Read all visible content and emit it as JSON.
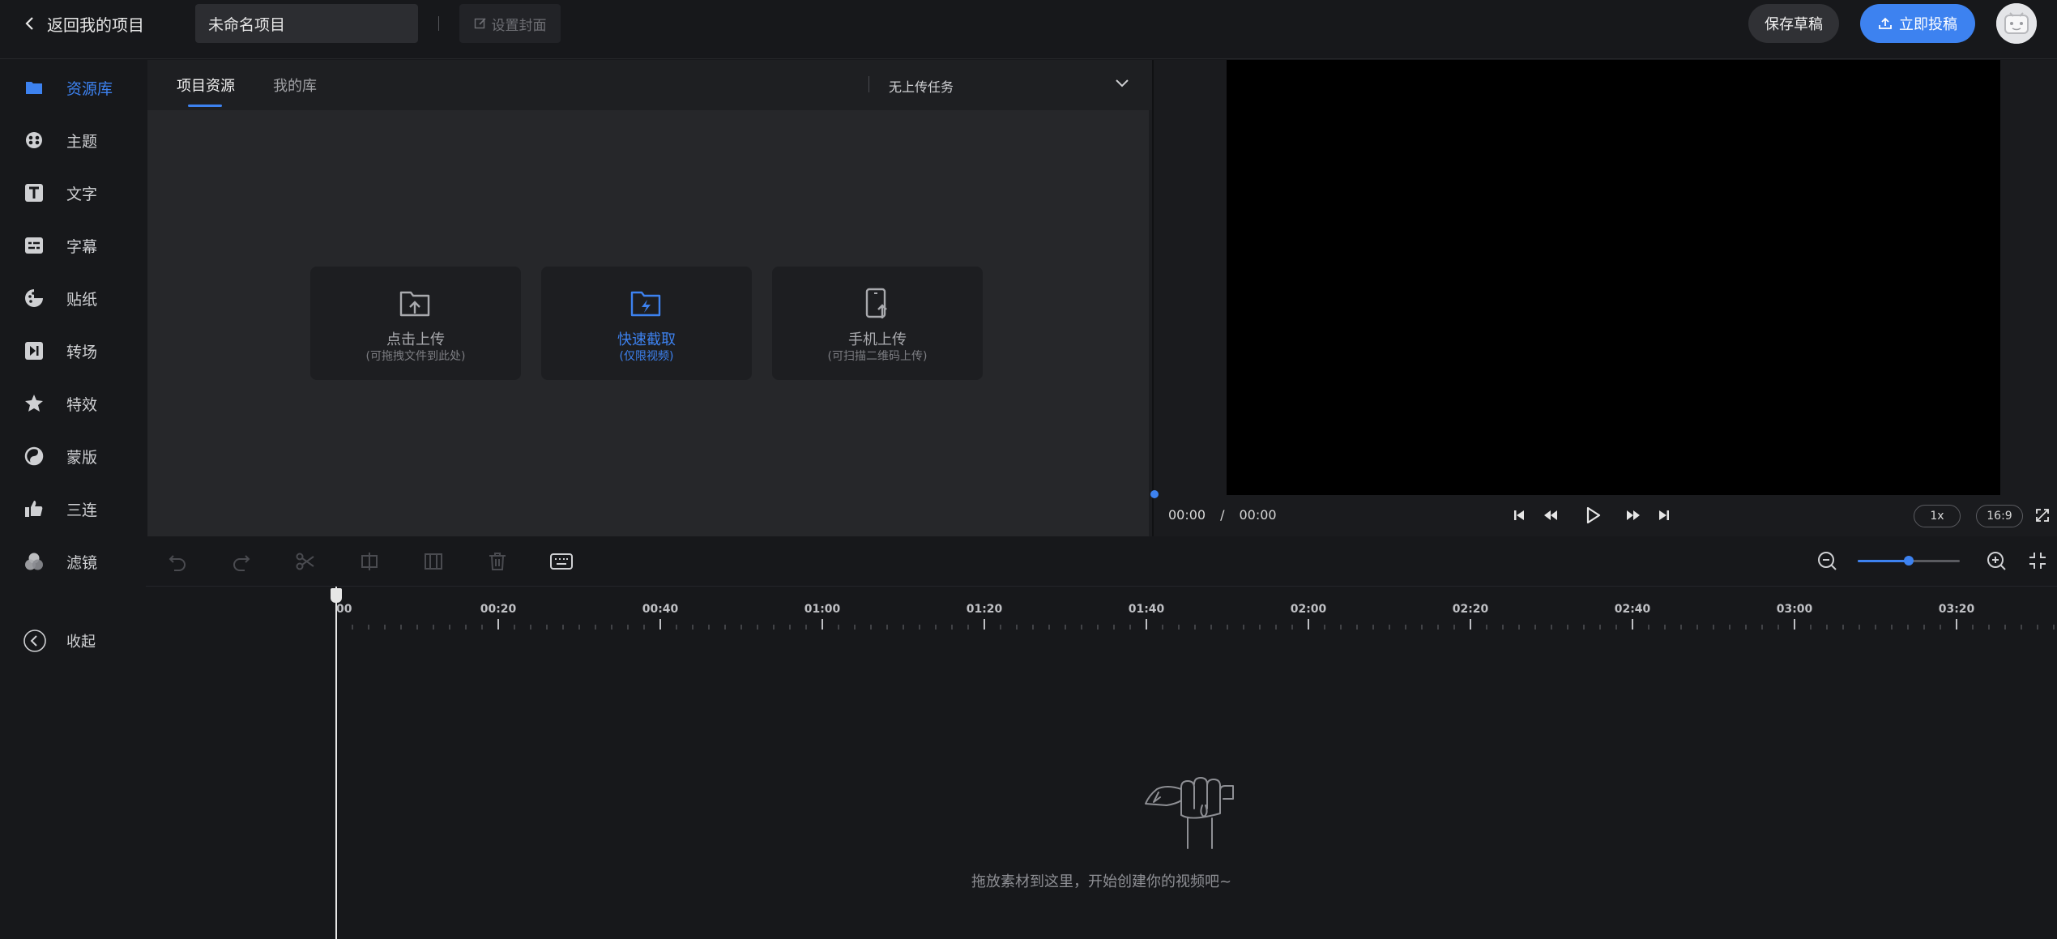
{
  "topbar": {
    "back_label": "返回我的项目",
    "project_name": "未命名项目",
    "cover_label": "设置封面",
    "save_label": "保存草稿",
    "publish_label": "立即投稿"
  },
  "sidebar": {
    "items": [
      {
        "label": "资源库",
        "icon": "folder-icon",
        "active": true
      },
      {
        "label": "主题",
        "icon": "theme-icon",
        "active": false
      },
      {
        "label": "文字",
        "icon": "text-icon",
        "active": false
      },
      {
        "label": "字幕",
        "icon": "subtitle-icon",
        "active": false
      },
      {
        "label": "贴纸",
        "icon": "sticker-icon",
        "active": false
      },
      {
        "label": "转场",
        "icon": "transition-icon",
        "active": false
      },
      {
        "label": "特效",
        "icon": "effects-icon",
        "active": false
      },
      {
        "label": "蒙版",
        "icon": "mask-icon",
        "active": false
      },
      {
        "label": "三连",
        "icon": "thumbs-up-icon",
        "active": false
      },
      {
        "label": "滤镜",
        "icon": "filter-icon",
        "active": false
      }
    ],
    "collapse_label": "收起"
  },
  "assets": {
    "tabs": [
      "项目资源",
      "我的库"
    ],
    "active_tab": 0,
    "upload_task_label": "无上传任务",
    "cards": [
      {
        "title": "点击上传",
        "subtitle": "(可拖拽文件到此处)",
        "icon": "folder-upload-icon"
      },
      {
        "title": "快速截取",
        "subtitle": "(仅限视频)",
        "icon": "folder-lightning-icon"
      },
      {
        "title": "手机上传",
        "subtitle": "(可扫描二维码上传)",
        "icon": "phone-upload-icon"
      }
    ]
  },
  "preview": {
    "current_time": "00:00",
    "separator": "/",
    "total_time": "00:00",
    "speed": "1x",
    "ratio": "16:9"
  },
  "timeline": {
    "zoom_level": 0.5,
    "ticks": [
      "00",
      "00:20",
      "00:40",
      "01:00",
      "01:20",
      "01:40",
      "02:00",
      "02:20",
      "02:40",
      "03:00",
      "03:20"
    ],
    "empty_text": "拖放素材到这里，开始创建你的视频吧~"
  },
  "colors": {
    "accent": "#3d82f0",
    "background": "#17181b",
    "panel": "#26272a"
  }
}
